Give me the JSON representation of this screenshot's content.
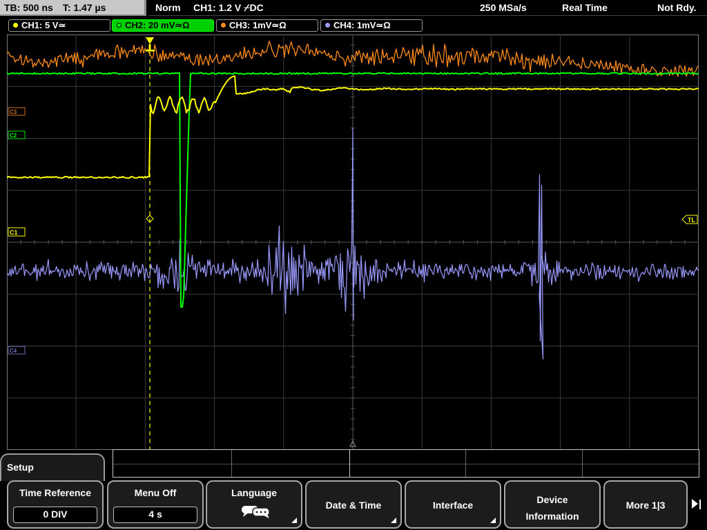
{
  "status": {
    "timebase": "TB: 500 ns",
    "trigger_time": "T: 1.47 µs",
    "trigger_mode": "Norm",
    "trigger_source": "CH1: 1.2 V ⌿DC",
    "sample_rate": "250 MSa/s",
    "acq_mode": "Real Time",
    "state": "Not Rdy."
  },
  "channels": [
    {
      "label": "CH1: 5 V≃",
      "color": "#ffff00",
      "active": false
    },
    {
      "label": "CH2: 20 mV≃Ω",
      "color": "#00ff00",
      "active": true
    },
    {
      "label": "CH3: 1mV≃Ω",
      "color": "#ff8c1a",
      "active": false
    },
    {
      "label": "CH4: 1mV≃Ω",
      "color": "#9a9aff",
      "active": false
    }
  ],
  "markers": {
    "ch1": "C1",
    "ch2": "C2",
    "ch3": "C3",
    "ch4": "C4",
    "trigger_level": "TL",
    "trigger_pos": "T"
  },
  "traces": {
    "ch1": {
      "color": "#ffff00",
      "pre_level": 2.75,
      "post_level": 1.35,
      "ring_amp": 0.15,
      "ring_end": 3.0,
      "bump_peak": 0.8,
      "bump_at": 3.1,
      "settled_level": 1.1,
      "final_level": 1.05
    },
    "ch2": {
      "color": "#00ff00",
      "level": 0.75,
      "dip_at": 2.5,
      "dip_bottom": 5.25,
      "after_level": 0.78
    },
    "ch3": {
      "color": "#ff8c1a",
      "start_level": 0.4,
      "mid_level": 0.5,
      "end_level": 0.7,
      "noise_amp": 0.25,
      "spike_at": 2.55,
      "spike_peak": -0.05
    },
    "ch4": {
      "color": "#9a9aff",
      "baseline": 4.55,
      "noise_amp": 0.18,
      "burst1_center": 4.0,
      "burst1_amp": 0.65,
      "burst2_center": 5.0,
      "burst2_amp": 1.1,
      "spike_at": 5.0,
      "spike_top": 1.8,
      "spike_bottom": 5.5,
      "burst3_at": 7.7,
      "burst3_top": 2.7,
      "burst3_bottom": 5.9
    }
  },
  "menu": {
    "title": "Setup",
    "softkeys": [
      {
        "label": "Time Reference",
        "value": "0 DIV"
      },
      {
        "label": "Menu Off",
        "value": "4 s"
      },
      {
        "label": "Language",
        "icon": "speech-bubbles-icon"
      },
      {
        "label": "Date & Time"
      },
      {
        "label": "Interface"
      },
      {
        "label": "Device Information"
      },
      {
        "label": "More 1|3"
      }
    ]
  }
}
